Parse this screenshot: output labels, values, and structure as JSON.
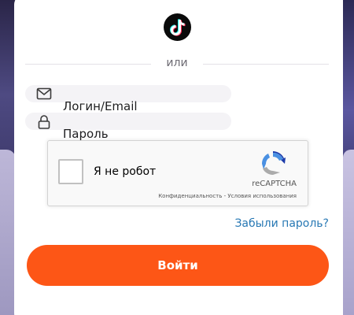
{
  "divider": {
    "text": "или"
  },
  "social": {
    "active_provider_icon": "tiktok-icon"
  },
  "form": {
    "login_label": "Логин/Email",
    "login_icon": "mail-icon",
    "password_label": "Пароль",
    "password_icon": "lock-icon"
  },
  "recaptcha": {
    "label": "Я не робот",
    "brand": "reCAPTCHA",
    "privacy": "Конфиденциальность",
    "separator": "-",
    "terms": "Условия использования"
  },
  "links": {
    "forgot_password": "Забыли пароль?"
  },
  "buttons": {
    "submit": "Войти"
  },
  "colors": {
    "accent": "#fd5616",
    "link": "#2778b4",
    "input_bg": "#f4f3f6"
  }
}
